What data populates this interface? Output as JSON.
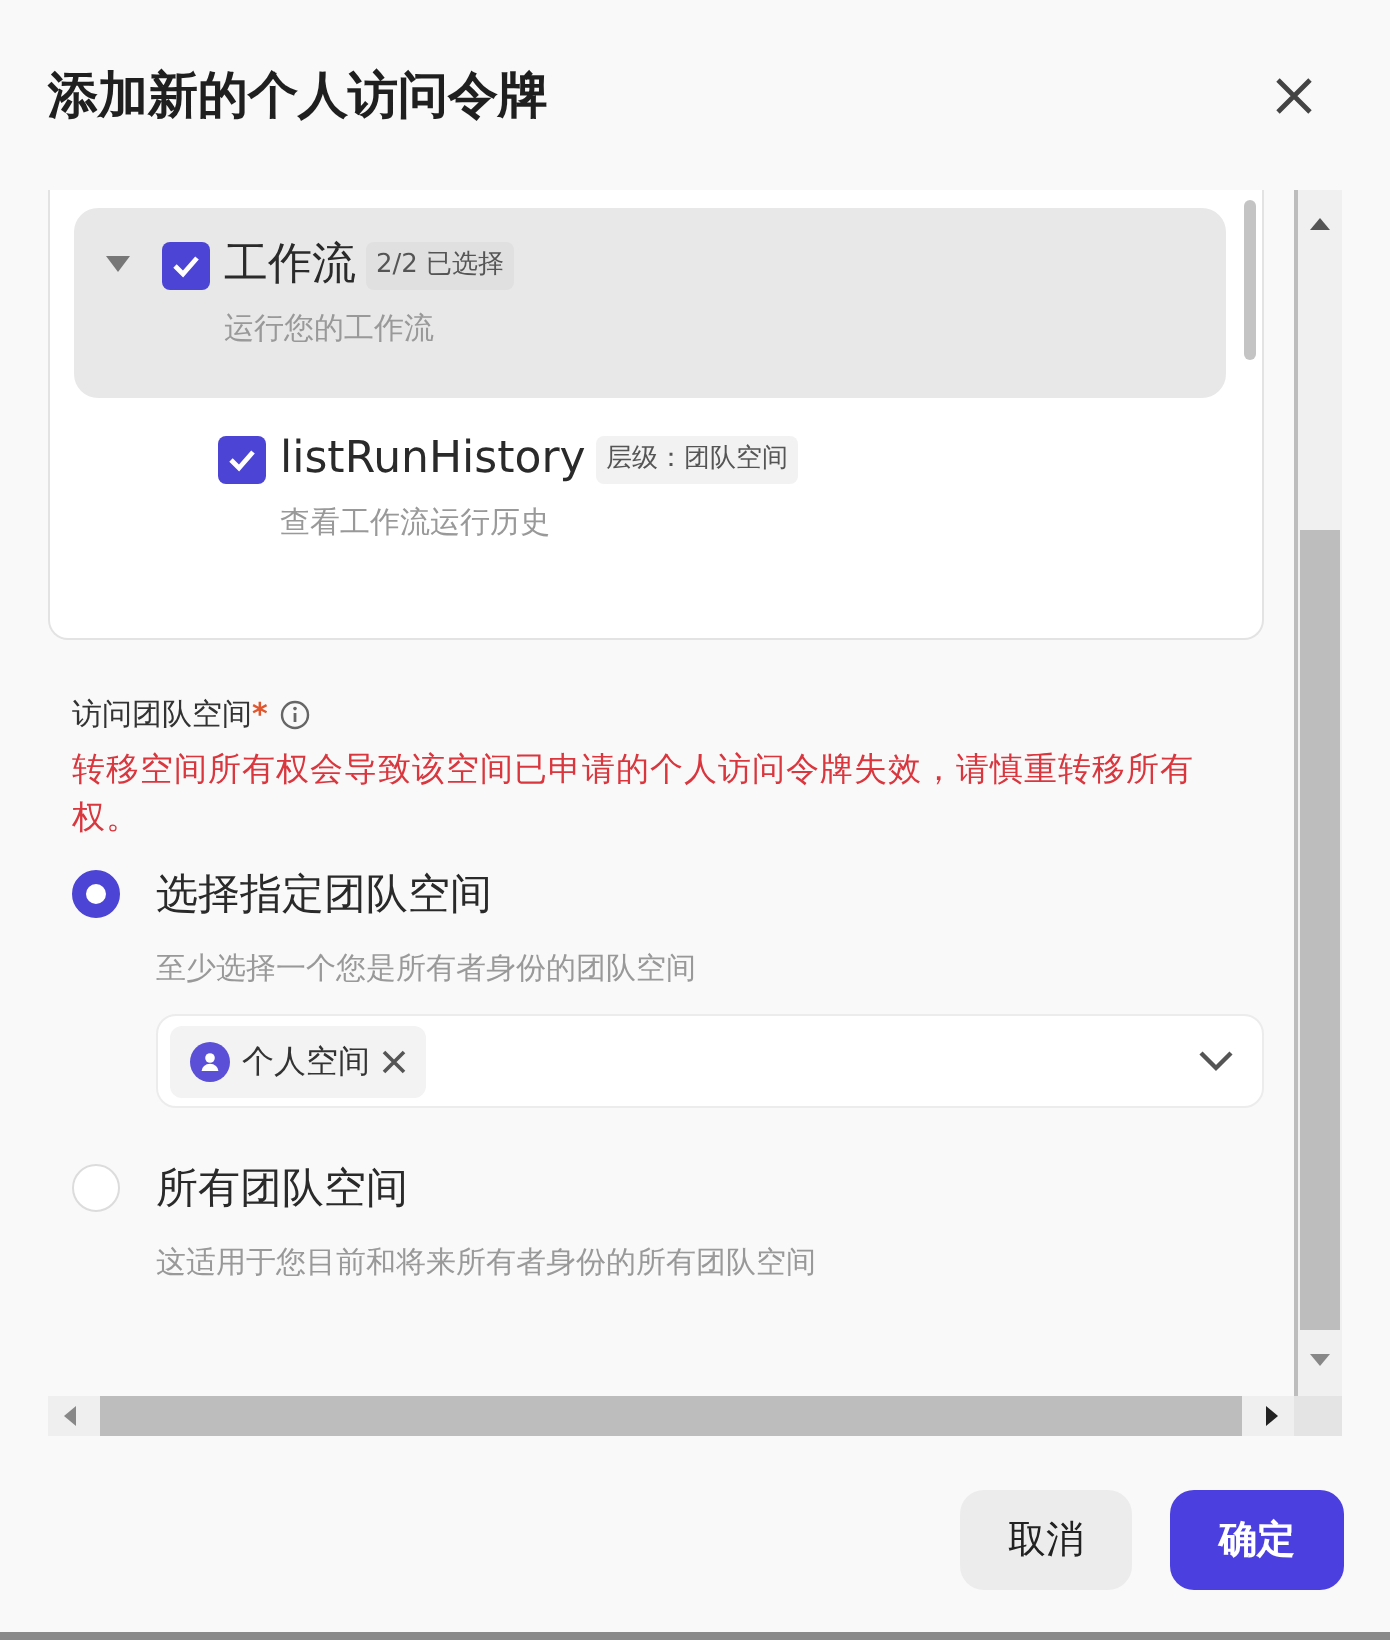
{
  "dialog": {
    "title": "添加新的个人访问令牌"
  },
  "permissions": [
    {
      "name": "工作流",
      "badge": "2/2 已选择",
      "description": "运行您的工作流",
      "checked": true,
      "expanded": true,
      "children": [
        {
          "name": "listRunHistory",
          "badge": "层级：团队空间",
          "description": "查看工作流运行历史",
          "checked": true
        }
      ]
    }
  ],
  "access": {
    "label": "访问团队空间",
    "required_mark": "*",
    "warning": "转移空间所有权会导致该空间已申请的个人访问令牌失效，请慎重转移所有权。",
    "options": [
      {
        "label": "选择指定团队空间",
        "description": "至少选择一个您是所有者身份的团队空间",
        "selected": true,
        "tags": [
          {
            "label": "个人空间"
          }
        ]
      },
      {
        "label": "所有团队空间",
        "description": "这适用于您目前和将来所有者身份的所有团队空间",
        "selected": false
      }
    ]
  },
  "buttons": [
    {
      "label": "取消",
      "kind": "secondary"
    },
    {
      "label": "确定",
      "kind": "primary"
    }
  ]
}
